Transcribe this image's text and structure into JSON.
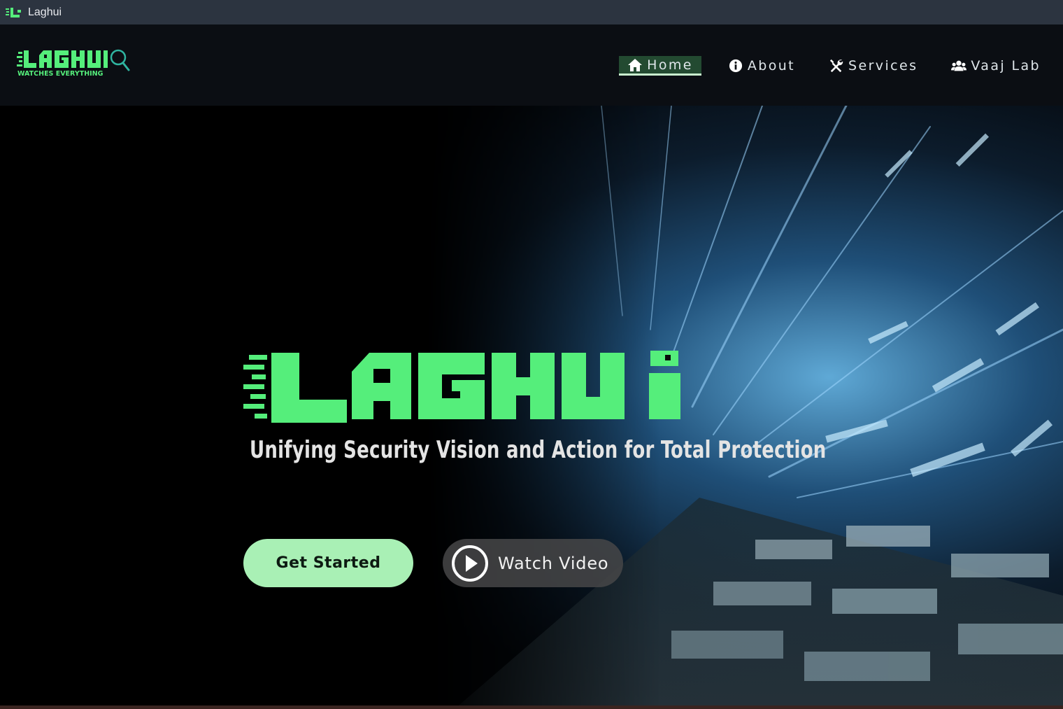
{
  "window": {
    "title": "Laghui"
  },
  "brand": {
    "logo_text": "LAGHUI",
    "logo_tagline": "WATCHES EVERYTHING",
    "hero_logo_text": "LAGHUi",
    "accent_color": "#55ee7b"
  },
  "nav": {
    "items": [
      {
        "label": "Home",
        "icon": "home-icon",
        "active": true
      },
      {
        "label": "About",
        "icon": "info-icon",
        "active": false
      },
      {
        "label": "Services",
        "icon": "tools-icon",
        "active": false
      },
      {
        "label": "Vaaj Lab",
        "icon": "users-icon",
        "active": false
      }
    ]
  },
  "hero": {
    "tagline": "Unifying Security Vision and Action for Total Protection",
    "primary_button": "Get Started",
    "secondary_button": "Watch Video",
    "secondary_icon": "play-icon"
  }
}
